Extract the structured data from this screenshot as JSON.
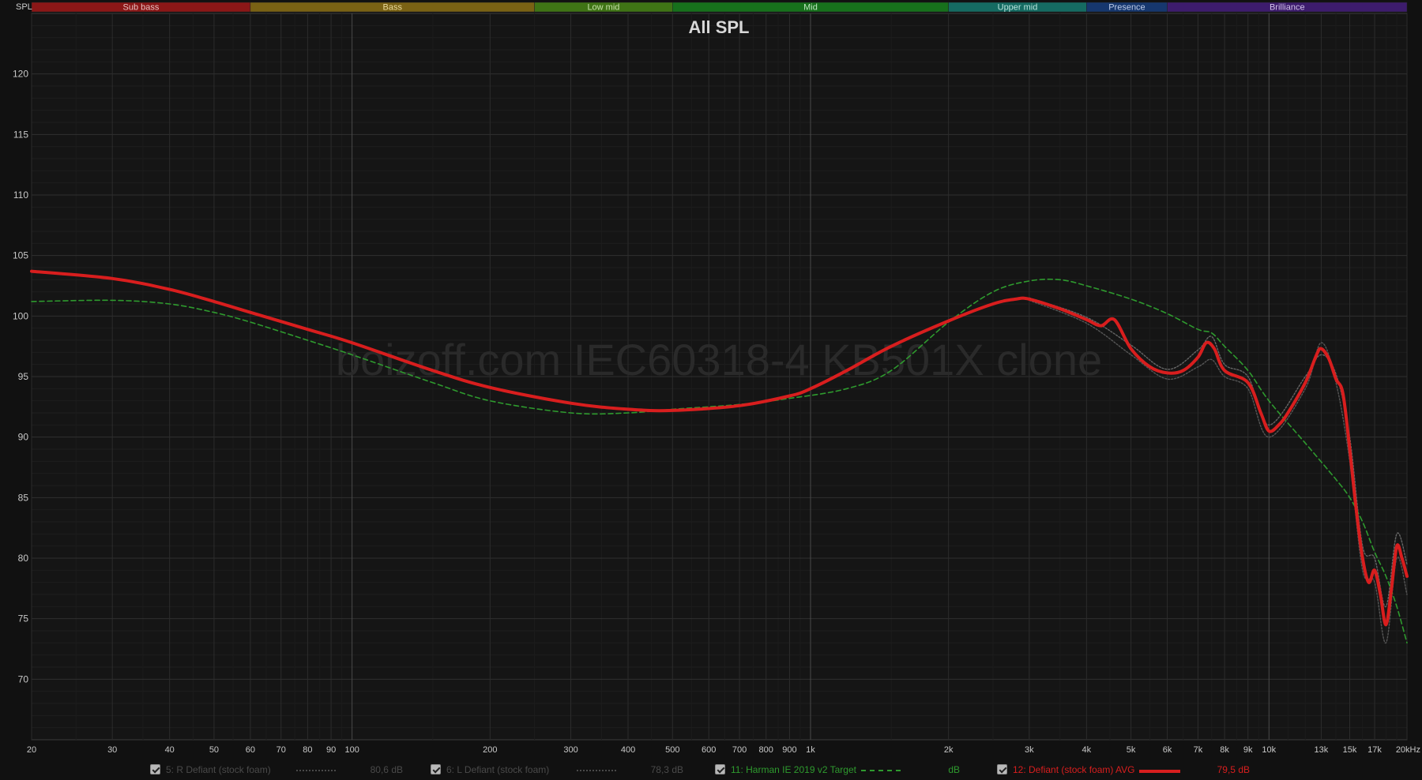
{
  "window": {
    "corner_label": "SPL"
  },
  "bands": [
    {
      "label": "Sub bass",
      "from": 20,
      "to": 60,
      "color": "#8b1717",
      "text": "#e6c0c0"
    },
    {
      "label": "Bass",
      "from": 60,
      "to": 250,
      "color": "#7a6214",
      "text": "#e8d89a"
    },
    {
      "label": "Low mid",
      "from": 250,
      "to": 500,
      "color": "#3f7415",
      "text": "#c6e3a8"
    },
    {
      "label": "Mid",
      "from": 500,
      "to": 2000,
      "color": "#17711c",
      "text": "#bfe6c0"
    },
    {
      "label": "Upper mid",
      "from": 2000,
      "to": 4000,
      "color": "#156b62",
      "text": "#b8e3dc"
    },
    {
      "label": "Presence",
      "from": 4000,
      "to": 6000,
      "color": "#16376e",
      "text": "#bccbe8"
    },
    {
      "label": "Brilliance",
      "from": 6000,
      "to": 20000,
      "color": "#3d1c6d",
      "text": "#d2c2ea"
    }
  ],
  "watermark": "boizoff.com IEC60318-4 KB501X clone",
  "chart_data": {
    "type": "line",
    "title": "All SPL",
    "xlabel": "",
    "ylabel": "",
    "x_scale": "log",
    "xlim": [
      20,
      20000
    ],
    "ylim": [
      65,
      125
    ],
    "grid": true,
    "y_ticks": [
      "120",
      "115",
      "110",
      "105",
      "100",
      "95",
      "90",
      "85",
      "80",
      "75",
      "70"
    ],
    "x_ticks": [
      {
        "f": 20,
        "label": "20"
      },
      {
        "f": 30,
        "label": "30"
      },
      {
        "f": 40,
        "label": "40"
      },
      {
        "f": 50,
        "label": "50"
      },
      {
        "f": 60,
        "label": "60"
      },
      {
        "f": 70,
        "label": "70"
      },
      {
        "f": 80,
        "label": "80"
      },
      {
        "f": 90,
        "label": "90"
      },
      {
        "f": 100,
        "label": "100"
      },
      {
        "f": 200,
        "label": "200"
      },
      {
        "f": 300,
        "label": "300"
      },
      {
        "f": 400,
        "label": "400"
      },
      {
        "f": 500,
        "label": "500"
      },
      {
        "f": 600,
        "label": "600"
      },
      {
        "f": 700,
        "label": "700"
      },
      {
        "f": 800,
        "label": "800"
      },
      {
        "f": 900,
        "label": "900"
      },
      {
        "f": 1000,
        "label": "1k"
      },
      {
        "f": 2000,
        "label": "2k"
      },
      {
        "f": 3000,
        "label": "3k"
      },
      {
        "f": 4000,
        "label": "4k"
      },
      {
        "f": 5000,
        "label": "5k"
      },
      {
        "f": 6000,
        "label": "6k"
      },
      {
        "f": 7000,
        "label": "7k"
      },
      {
        "f": 8000,
        "label": "8k"
      },
      {
        "f": 9000,
        "label": "9k"
      },
      {
        "f": 10000,
        "label": "10k"
      },
      {
        "f": 13000,
        "label": "13k"
      },
      {
        "f": 15000,
        "label": "15k"
      },
      {
        "f": 17000,
        "label": "17k"
      },
      {
        "f": 20000,
        "label": "20kHz"
      }
    ],
    "series": [
      {
        "name": "11: Harman IE 2019 v2 Target",
        "color": "#2e9a2e",
        "style": "dashed",
        "points": [
          [
            20,
            101.2
          ],
          [
            30,
            101.3
          ],
          [
            40,
            101.0
          ],
          [
            50,
            100.3
          ],
          [
            60,
            99.5
          ],
          [
            80,
            98.0
          ],
          [
            100,
            96.8
          ],
          [
            150,
            94.5
          ],
          [
            200,
            93.0
          ],
          [
            300,
            92.0
          ],
          [
            400,
            92.0
          ],
          [
            500,
            92.3
          ],
          [
            700,
            92.7
          ],
          [
            900,
            93.2
          ],
          [
            1200,
            94.0
          ],
          [
            1500,
            95.5
          ],
          [
            2000,
            99.5
          ],
          [
            2500,
            102.0
          ],
          [
            3000,
            102.9
          ],
          [
            3500,
            103.0
          ],
          [
            4000,
            102.5
          ],
          [
            5000,
            101.4
          ],
          [
            6000,
            100.2
          ],
          [
            7000,
            98.9
          ],
          [
            7500,
            98.6
          ],
          [
            8000,
            97.5
          ],
          [
            9000,
            95.5
          ],
          [
            10000,
            93.0
          ],
          [
            12000,
            89.5
          ],
          [
            14000,
            86.5
          ],
          [
            15000,
            85.0
          ],
          [
            16000,
            83.0
          ],
          [
            17000,
            80.5
          ],
          [
            18000,
            78.5
          ],
          [
            19000,
            76.0
          ],
          [
            20000,
            73.0
          ]
        ]
      },
      {
        "name": "12: Defiant (stock foam) AVG",
        "color": "#d81e1e",
        "style": "solid",
        "points": [
          [
            20,
            103.7
          ],
          [
            30,
            103.1
          ],
          [
            40,
            102.2
          ],
          [
            50,
            101.2
          ],
          [
            60,
            100.3
          ],
          [
            80,
            98.9
          ],
          [
            100,
            97.8
          ],
          [
            150,
            95.5
          ],
          [
            200,
            94.1
          ],
          [
            300,
            92.8
          ],
          [
            400,
            92.3
          ],
          [
            500,
            92.2
          ],
          [
            700,
            92.6
          ],
          [
            900,
            93.4
          ],
          [
            1000,
            94.0
          ],
          [
            1200,
            95.5
          ],
          [
            1500,
            97.5
          ],
          [
            2000,
            99.6
          ],
          [
            2500,
            101.0
          ],
          [
            2800,
            101.4
          ],
          [
            3000,
            101.4
          ],
          [
            3500,
            100.6
          ],
          [
            4000,
            99.7
          ],
          [
            4300,
            99.2
          ],
          [
            4600,
            99.7
          ],
          [
            5000,
            97.3
          ],
          [
            5500,
            95.8
          ],
          [
            6000,
            95.3
          ],
          [
            6500,
            95.5
          ],
          [
            7000,
            96.6
          ],
          [
            7300,
            97.8
          ],
          [
            7600,
            97.3
          ],
          [
            8000,
            95.5
          ],
          [
            9000,
            94.5
          ],
          [
            9600,
            92.0
          ],
          [
            10000,
            90.5
          ],
          [
            10500,
            91.0
          ],
          [
            11000,
            92.0
          ],
          [
            12000,
            94.5
          ],
          [
            12700,
            96.8
          ],
          [
            13000,
            97.3
          ],
          [
            13500,
            96.5
          ],
          [
            14000,
            94.8
          ],
          [
            14500,
            93.6
          ],
          [
            15000,
            89.0
          ],
          [
            15500,
            84.0
          ],
          [
            16000,
            80.0
          ],
          [
            16500,
            78.0
          ],
          [
            17000,
            79.0
          ],
          [
            17500,
            77.0
          ],
          [
            18000,
            74.5
          ],
          [
            18500,
            77.5
          ],
          [
            19000,
            81.0
          ],
          [
            19500,
            80.0
          ],
          [
            20000,
            78.5
          ]
        ]
      },
      {
        "name": "5: R Defiant (stock foam)",
        "color": "#555555",
        "style": "dotted",
        "points": [
          [
            3000,
            101.3
          ],
          [
            4000,
            99.4
          ],
          [
            5000,
            96.8
          ],
          [
            6000,
            94.8
          ],
          [
            7000,
            95.8
          ],
          [
            7500,
            96.4
          ],
          [
            8000,
            95.0
          ],
          [
            9000,
            94.0
          ],
          [
            10000,
            90.0
          ],
          [
            12000,
            94.0
          ],
          [
            13000,
            97.8
          ],
          [
            14000,
            94.5
          ],
          [
            15000,
            88.0
          ],
          [
            16000,
            79.0
          ],
          [
            17000,
            78.0
          ],
          [
            18000,
            73.0
          ],
          [
            19000,
            80.0
          ],
          [
            20000,
            77.0
          ]
        ]
      },
      {
        "name": "6: L Defiant (stock foam)",
        "color": "#666666",
        "style": "dotted",
        "points": [
          [
            3000,
            101.5
          ],
          [
            4000,
            99.9
          ],
          [
            5000,
            97.6
          ],
          [
            6000,
            95.6
          ],
          [
            7000,
            97.2
          ],
          [
            7500,
            98.3
          ],
          [
            8000,
            96.0
          ],
          [
            9000,
            95.0
          ],
          [
            10000,
            91.0
          ],
          [
            12000,
            95.0
          ],
          [
            13000,
            96.8
          ],
          [
            14000,
            95.2
          ],
          [
            15000,
            90.0
          ],
          [
            16000,
            81.0
          ],
          [
            17000,
            80.0
          ],
          [
            18000,
            76.0
          ],
          [
            19000,
            82.0
          ],
          [
            20000,
            79.5
          ]
        ]
      }
    ]
  },
  "legend": [
    {
      "name": "5: R Defiant (stock foam)",
      "value": "80,6 dB",
      "text_color": "#4a4a4a",
      "line": "#4a4a4a",
      "line_style": "dotted",
      "left": 0
    },
    {
      "name": "6: L Defiant (stock foam)",
      "value": "78,3 dB",
      "text_color": "#4a4a4a",
      "line": "#4a4a4a",
      "line_style": "dotted",
      "left": 1
    },
    {
      "name": "11: Harman IE 2019 v2 Target",
      "value": "dB",
      "text_color": "#2e9a2e",
      "line": "#2e9a2e",
      "line_style": "dashed",
      "left": 2
    },
    {
      "name": "12: Defiant (stock foam) AVG",
      "value": "79,5 dB",
      "text_color": "#d81e1e",
      "line": "#d81e1e",
      "line_style": "solid",
      "left": 3
    }
  ]
}
